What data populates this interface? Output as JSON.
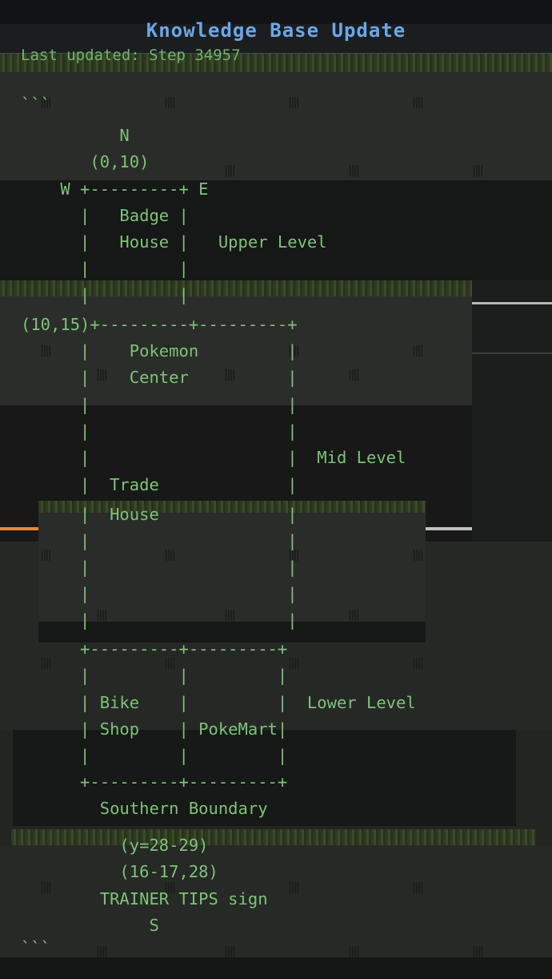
{
  "header": {
    "title": "Knowledge Base Update",
    "last_updated": "Last updated: Step 34957"
  },
  "map_lines": [
    "```",
    "          N",
    "       (0,10)",
    "    W +---------+ E",
    "      |   Badge |",
    "      |   House |   Upper Level",
    "      |         |",
    "      |         |",
    "(10,15)+---------+---------+",
    "      |    Pokemon         |",
    "      |    Center          |",
    "      |                    |",
    "      |                    |",
    "      |                    |  Mid Level",
    "      |  Trade             |",
    "      |  House             |",
    "      |                    |",
    "      |                    |",
    "      |                    |",
    "      |                    |",
    "      +---------+---------+",
    "      |         |         |",
    "      | Bike    |         |  Lower Level",
    "      | Shop    | PokeMart|",
    "      |         |         |",
    "      +---------+---------+",
    "        Southern Boundary",
    "          (y=28-29)",
    "          (16-17,28)",
    "        TRAINER TIPS sign",
    "             S",
    "```"
  ],
  "colors": {
    "title": "#6aa7e8",
    "text": "#7dc476",
    "accent_orange": "#e8873a"
  }
}
